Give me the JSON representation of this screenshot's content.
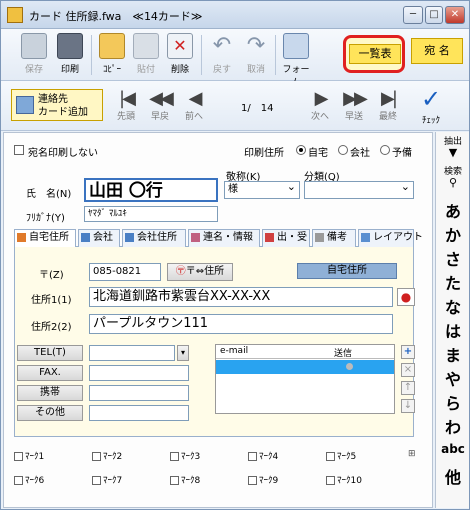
{
  "window": {
    "title": "カード 住所録.fwa",
    "subtitle": "≪14カード≫",
    "controls": {
      "minimize": "─",
      "maximize": "□",
      "close": "✕"
    }
  },
  "toolbar": {
    "buttons": [
      {
        "id": "save",
        "label": "保存",
        "icon": "floppy-disk-icon",
        "disabled": true
      },
      {
        "id": "print",
        "label": "印刷",
        "icon": "printer-icon",
        "disabled": false
      },
      {
        "id": "copy",
        "label": "ｺﾋﾟｰ",
        "icon": "copy-icon",
        "disabled": false
      },
      {
        "id": "paste",
        "label": "貼付",
        "icon": "paste-icon",
        "disabled": true
      },
      {
        "id": "delete",
        "label": "削除",
        "icon": "delete-card-icon",
        "disabled": false
      },
      {
        "id": "undo",
        "label": "戻す",
        "icon": "undo-icon",
        "disabled": true
      },
      {
        "id": "cancel",
        "label": "取消",
        "icon": "redo-icon",
        "disabled": true
      },
      {
        "id": "form",
        "label": "フォーム",
        "icon": "form-icon",
        "disabled": false
      }
    ],
    "list_button": "一覧表",
    "atena_button": "宛 名"
  },
  "nav": {
    "add_card_line1": "連絡先",
    "add_card_line2": "カード追加",
    "first": "先頭",
    "prev_page": "早戻",
    "prev": "前へ",
    "next": "次へ",
    "next_page": "早送",
    "last": "最終",
    "check": "ﾁｪｯｸ",
    "current": "1/",
    "total": "14"
  },
  "form": {
    "no_print_label": "宛名印刷しない",
    "print_address_label": "印刷住所",
    "print_address_options": [
      "自宅",
      "会社",
      "予備"
    ],
    "print_address_selected": "自宅",
    "name_label": "氏　名(N)",
    "name_value": "山田 〇行",
    "furigana_label": "ﾌﾘｶﾞﾅ(Y)",
    "furigana_value": "ﾔﾏﾀﾞ ﾏﾙﾕｷ",
    "honorific_label": "敬称(K)",
    "honorific_value": "様",
    "category_label": "分類(Q)",
    "category_value": ""
  },
  "tabs": [
    {
      "label": "自宅住所",
      "active": true
    },
    {
      "label": "会社",
      "active": false
    },
    {
      "label": "会社住所",
      "active": false
    },
    {
      "label": "連名・情報",
      "active": false
    },
    {
      "label": "出・受",
      "active": false
    },
    {
      "label": "備考",
      "active": false
    },
    {
      "label": "レイアウト",
      "active": false
    }
  ],
  "home": {
    "zip_label": "〒(Z)",
    "zip_value": "085-0821",
    "zip_convert_button": "〒⇔住所",
    "section_header": "自宅住所",
    "address1_label": "住所1(1)",
    "address1_value": "北海道釧路市紫雲台XX-XX-XX",
    "address2_label": "住所2(2)",
    "address2_value": "パープルタウン111",
    "tel_label": "TEL(T)",
    "fax_label": "FAX.",
    "mobile_label": "携帯",
    "other_label": "その他",
    "tel_value": "",
    "fax_value": "",
    "mobile_value": "",
    "other_value": "",
    "email_header": "e-mail",
    "send_header": "送信",
    "email_add": "+",
    "email_delete": "×",
    "email_up": "↑",
    "email_down": "↓"
  },
  "marks": [
    "ﾏｰｸ1",
    "ﾏｰｸ2",
    "ﾏｰｸ3",
    "ﾏｰｸ4",
    "ﾏｰｸ5",
    "ﾏｰｸ6",
    "ﾏｰｸ7",
    "ﾏｰｸ8",
    "ﾏｰｸ9",
    "ﾏｰｸ10"
  ],
  "marks_extra": "⊞",
  "sidebar": {
    "extract": "抽出",
    "search": "検索",
    "kana": [
      "あ",
      "か",
      "さ",
      "た",
      "な",
      "は",
      "ま",
      "や",
      "ら",
      "わ",
      "abc",
      "他"
    ]
  }
}
